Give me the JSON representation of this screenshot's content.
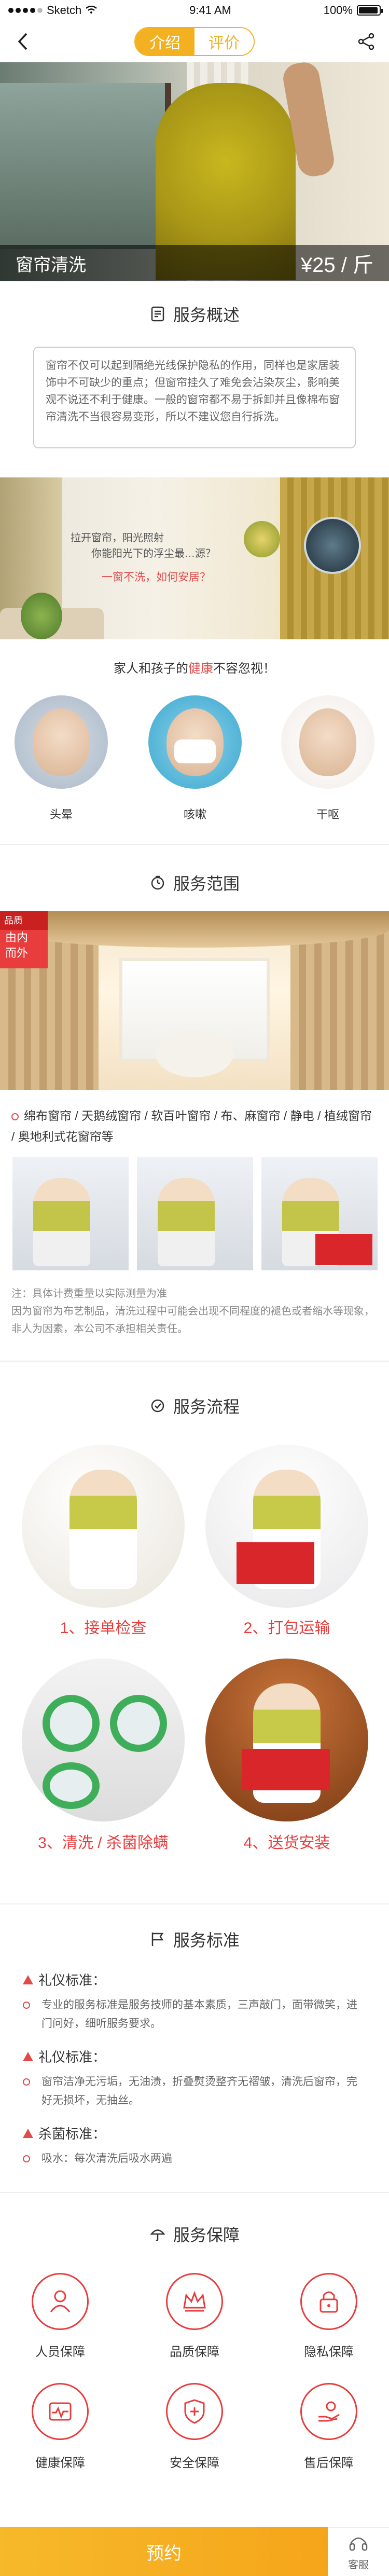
{
  "status_bar": {
    "carrier": "Sketch",
    "time": "9:41 AM",
    "battery": "100%"
  },
  "nav": {
    "tabs": [
      {
        "label": "介绍"
      },
      {
        "label": "评价"
      }
    ]
  },
  "hero": {
    "title": "窗帘清洗",
    "price": "¥25 / 斤"
  },
  "overview": {
    "title": "服务概述",
    "text": "窗帘不仅可以起到隔绝光线保护隐私的作用，同样也是家居装饰中不可缺少的重点；但窗帘挂久了难免会沾染灰尘，影响美观不说还不利于健康。一般的窗帘都不易于拆卸并且像棉布窗帘清洗不当很容易变形，所以不建议您自行拆洗。"
  },
  "banner2": {
    "line1": "拉开窗帘，阳光照射",
    "line2": "你能阳光下的浮尘最…源？",
    "line3": "一窗不洗，如何安居？"
  },
  "health": {
    "title_prefix": "家人和孩子的",
    "title_red": "健康",
    "title_suffix": "不容忽视！",
    "items": [
      {
        "label": "头晕"
      },
      {
        "label": "咳嗽"
      },
      {
        "label": "干呕"
      }
    ]
  },
  "scope": {
    "title": "服务范围",
    "badge_top": "品质",
    "badge_line1": "由内",
    "badge_line2": "而外",
    "text": "绵布窗帘 / 天鹅绒窗帘 / 软百叶窗帘 / 布、麻窗帘 / 静电 / 植绒窗帘 / 奥地利式花窗帘等",
    "note_line1": "注：具体计费重量以实际测量为准",
    "note_line2": "因为窗帘为布艺制品，清洗过程中可能会出现不同程度的褪色或者缩水等现象，非人为因素，本公司不承担相关责任。"
  },
  "process": {
    "title": "服务流程",
    "steps": [
      {
        "label": "1、接单检查"
      },
      {
        "label": "2、打包运输"
      },
      {
        "label": "3、清洗 / 杀菌除螨"
      },
      {
        "label": "4、送货安装"
      }
    ]
  },
  "standards": {
    "title": "服务标准",
    "items": [
      {
        "head": "礼仪标准：",
        "body": "专业的服务标准是服务技师的基本素质，三声敲门，面带微笑，进门问好，细听服务要求。"
      },
      {
        "head": "礼仪标准：",
        "body": "窗帘洁净无污垢，无油渍，折叠熨烫整齐无褶皱，清洗后窗帘，完好无损坏，无抽丝。"
      },
      {
        "head": "杀菌标准：",
        "body": "吸水：每次清洗后吸水两遍"
      }
    ]
  },
  "guarantee": {
    "title": "服务保障",
    "items": [
      {
        "label": "人员保障",
        "icon": "person-icon"
      },
      {
        "label": "品质保障",
        "icon": "crown-icon"
      },
      {
        "label": "隐私保障",
        "icon": "lock-icon"
      },
      {
        "label": "健康保障",
        "icon": "heartbeat-icon"
      },
      {
        "label": "安全保障",
        "icon": "shield-plus-icon"
      },
      {
        "label": "售后保障",
        "icon": "hand-icon"
      }
    ]
  },
  "bottom": {
    "book_label": "预约",
    "service_label": "客服"
  },
  "colors": {
    "accent_orange": "#f3b020",
    "accent_red": "#e93c3c"
  }
}
